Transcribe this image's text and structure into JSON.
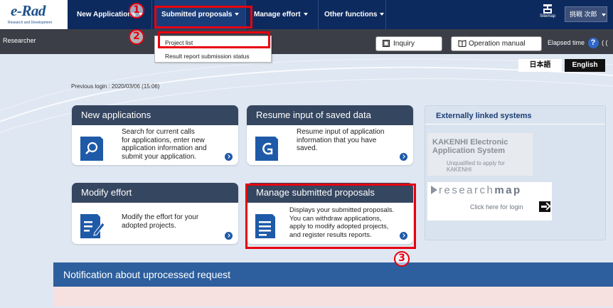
{
  "logo": {
    "main": "e-Rad",
    "sub": "Research and Development"
  },
  "nav": {
    "items": [
      {
        "label": "New Applications"
      },
      {
        "label": "Submitted proposals"
      },
      {
        "label": "Manage effort"
      },
      {
        "label": "Other functions"
      }
    ],
    "sitemap_label": "Sitemap",
    "user_name": "挑戦 次郎"
  },
  "subbar": {
    "role": "Researcher",
    "inquiry_label": "Inquiry",
    "manual_label": "Operation manual",
    "elapsed_label": "Elapsed time",
    "help_symbol": "?",
    "elapsed_suffix": "( ("
  },
  "dropdown": {
    "items": [
      {
        "label": "Project list"
      },
      {
        "label": "Result report submission status"
      }
    ]
  },
  "language": {
    "japanese": "日本語",
    "english": "English"
  },
  "previous_login": "Previous login : 2020/03/06 (15:06)",
  "cards": [
    {
      "title": "New applications",
      "text": [
        "Search for current calls",
        "for applications, enter new",
        "application information and",
        "submit your application."
      ],
      "icon": "search-document-icon"
    },
    {
      "title": "Resume input of saved data",
      "text": [
        "Resume input of application",
        "information that you have",
        "saved."
      ],
      "icon": "resume-document-icon"
    },
    {
      "title": "Modify effort",
      "text": [
        "Modify the effort for your",
        "adopted projects."
      ],
      "icon": "edit-document-icon"
    },
    {
      "title": "Manage submitted proposals",
      "text": [
        "Displays your submitted proposals.",
        "You can withdraw applications,",
        "apply to modify adopted projects,",
        "and register results reports."
      ],
      "icon": "document-list-icon"
    }
  ],
  "external": {
    "title": "Externally linked systems",
    "kakenhi_title_1": "KAKENHI Electronic",
    "kakenhi_title_2": "Application System",
    "kakenhi_note_1": "Unqualified to apply for",
    "kakenhi_note_2": "KAKENHI",
    "researchmap_logo_1": "research",
    "researchmap_logo_2": "map",
    "researchmap_login": "Click here for login"
  },
  "notification": {
    "title": "Notification about uprocessed request"
  },
  "annotations": {
    "step1": "1",
    "step2": "2",
    "step3": "3"
  },
  "colors": {
    "nav_bg": "#0d2a5e",
    "subbar_bg": "#3b3e47",
    "card_head": "#354660",
    "notif_head": "#2d5f9e",
    "annotation_red": "#e8000e"
  }
}
